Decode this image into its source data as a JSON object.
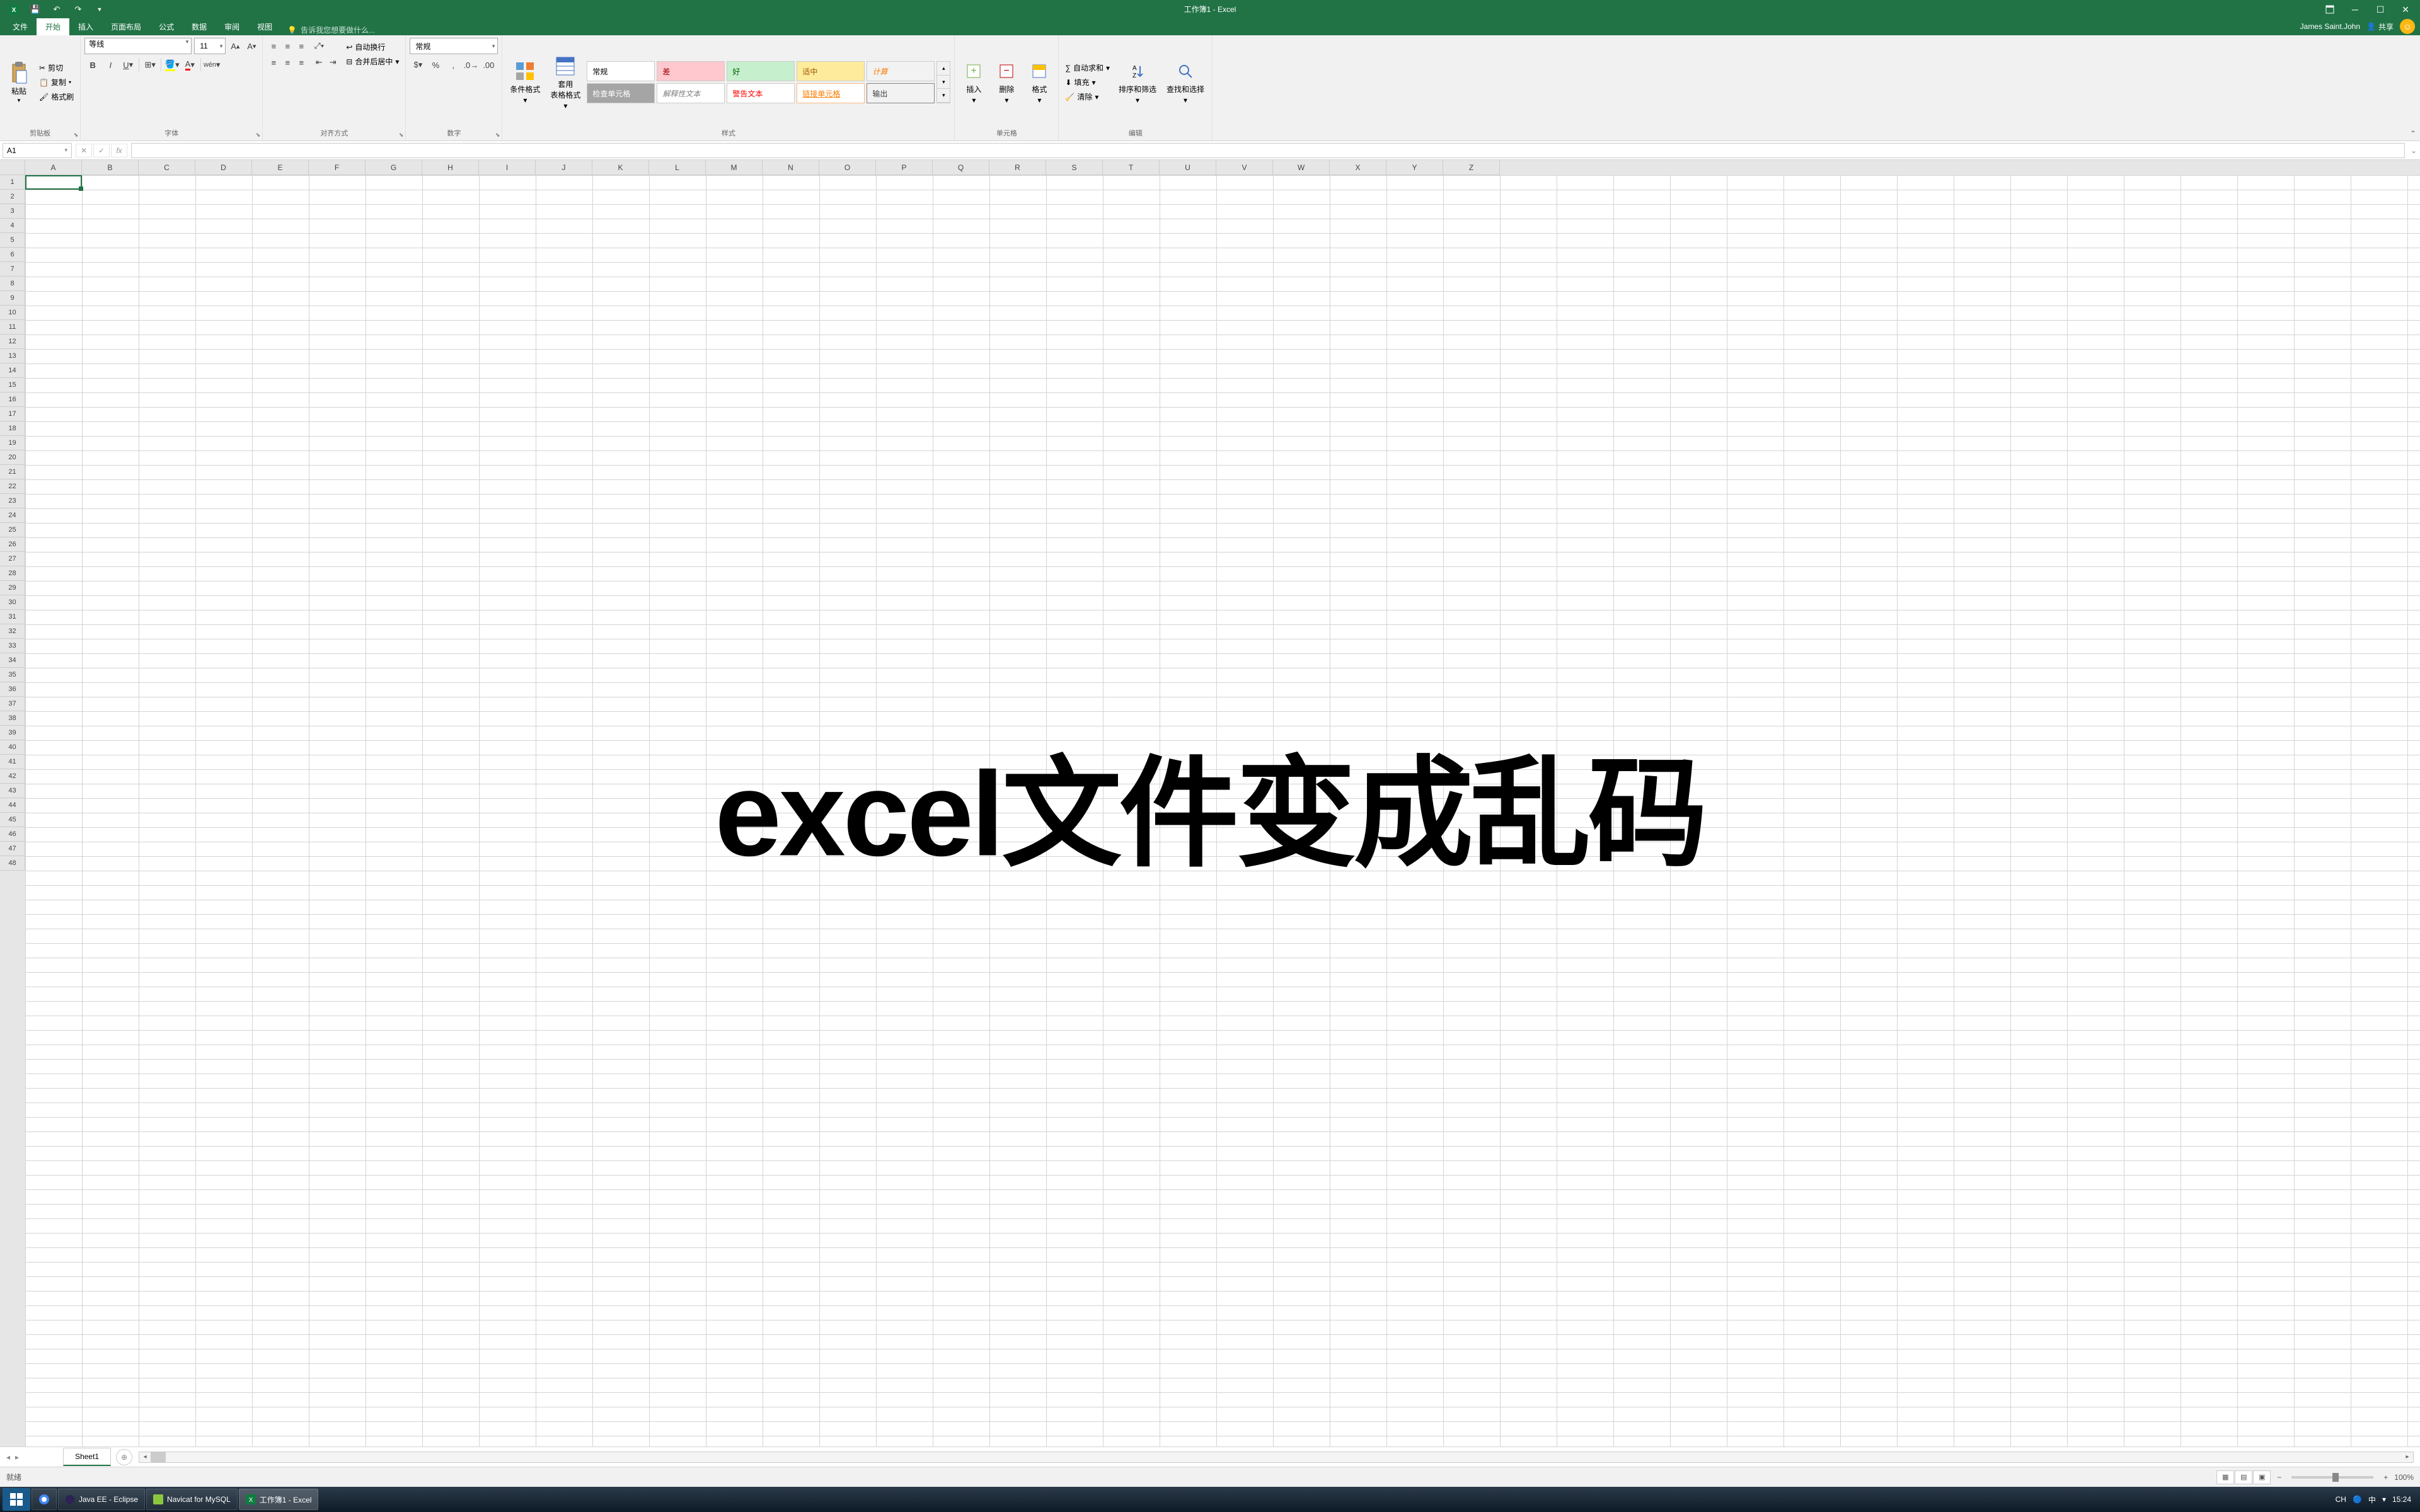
{
  "title": "工作簿1 - Excel",
  "user": "James Saint.John",
  "share": "共享",
  "tabs": {
    "file": "文件",
    "home": "开始",
    "insert": "插入",
    "layout": "页面布局",
    "formulas": "公式",
    "data": "数据",
    "review": "审阅",
    "view": "视图"
  },
  "tellme": "告诉我您想要做什么...",
  "clipboard": {
    "paste": "粘贴",
    "cut": "剪切",
    "copy": "复制",
    "format_painter": "格式刷",
    "label": "剪贴板"
  },
  "font": {
    "name": "等线",
    "size": "11",
    "label": "字体"
  },
  "alignment": {
    "wrap": "自动换行",
    "merge": "合并后居中",
    "label": "对齐方式"
  },
  "number": {
    "format": "常规",
    "label": "数字"
  },
  "styles": {
    "cond": "条件格式",
    "table": "套用\n表格格式",
    "normal": "常规",
    "bad": "差",
    "good": "好",
    "neutral": "适中",
    "calc": "计算",
    "check": "检查单元格",
    "explanatory": "解释性文本",
    "warning": "警告文本",
    "link": "链接单元格",
    "output": "输出",
    "label": "样式"
  },
  "cells": {
    "insert": "插入",
    "delete": "删除",
    "format": "格式",
    "label": "单元格"
  },
  "editing": {
    "autosum": "自动求和",
    "fill": "填充",
    "clear": "清除",
    "sort": "排序和筛选",
    "find": "查找和选择",
    "label": "编辑"
  },
  "namebox": "A1",
  "columns": [
    "A",
    "B",
    "C",
    "D",
    "E",
    "F",
    "G",
    "H",
    "I",
    "J",
    "K",
    "L",
    "M",
    "N",
    "O",
    "P",
    "Q",
    "R",
    "S",
    "T",
    "U",
    "V",
    "W",
    "X",
    "Y",
    "Z"
  ],
  "rows_count": 48,
  "overlay": "excel文件变成乱码",
  "sheet": "Sheet1",
  "status": "就绪",
  "zoom": "100%",
  "taskbar": {
    "eclipse": "Java EE - Eclipse",
    "navicat": "Navicat for MySQL",
    "excel": "工作簿1 - Excel",
    "ime": "CH",
    "ime2": "中",
    "time": "15:24"
  }
}
